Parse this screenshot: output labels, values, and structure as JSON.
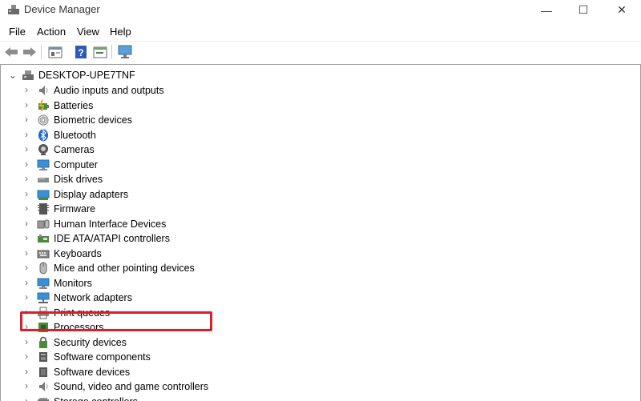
{
  "window": {
    "title": "Device Manager",
    "minimize": "—",
    "maximize": "☐",
    "close": "✕"
  },
  "menu": [
    "File",
    "Action",
    "View",
    "Help"
  ],
  "toolbar": [
    "back-icon",
    "forward-icon",
    "properties-icon",
    "help-icon",
    "show-hidden-icon",
    "scan-hardware-icon"
  ],
  "tree": {
    "root": "DESKTOP-UPE7TNF",
    "items": [
      {
        "label": "Audio inputs and outputs",
        "icon": "speaker-icon"
      },
      {
        "label": "Batteries",
        "icon": "battery-icon"
      },
      {
        "label": "Biometric devices",
        "icon": "fingerprint-icon"
      },
      {
        "label": "Bluetooth",
        "icon": "bluetooth-icon"
      },
      {
        "label": "Cameras",
        "icon": "camera-icon"
      },
      {
        "label": "Computer",
        "icon": "computer-icon"
      },
      {
        "label": "Disk drives",
        "icon": "disk-icon"
      },
      {
        "label": "Display adapters",
        "icon": "display-adapter-icon"
      },
      {
        "label": "Firmware",
        "icon": "firmware-icon"
      },
      {
        "label": "Human Interface Devices",
        "icon": "hid-icon"
      },
      {
        "label": "IDE ATA/ATAPI controllers",
        "icon": "ide-controller-icon"
      },
      {
        "label": "Keyboards",
        "icon": "keyboard-icon"
      },
      {
        "label": "Mice and other pointing devices",
        "icon": "mouse-icon"
      },
      {
        "label": "Monitors",
        "icon": "monitor-icon"
      },
      {
        "label": "Network adapters",
        "icon": "network-icon"
      },
      {
        "label": "Print queues",
        "icon": "printer-icon"
      },
      {
        "label": "Processors",
        "icon": "processor-icon"
      },
      {
        "label": "Security devices",
        "icon": "security-icon"
      },
      {
        "label": "Software components",
        "icon": "software-component-icon"
      },
      {
        "label": "Software devices",
        "icon": "software-device-icon"
      },
      {
        "label": "Sound, video and game controllers",
        "icon": "speaker-icon"
      },
      {
        "label": "Storage controllers",
        "icon": "storage-icon"
      }
    ]
  },
  "highlight_color": "#d6202a"
}
